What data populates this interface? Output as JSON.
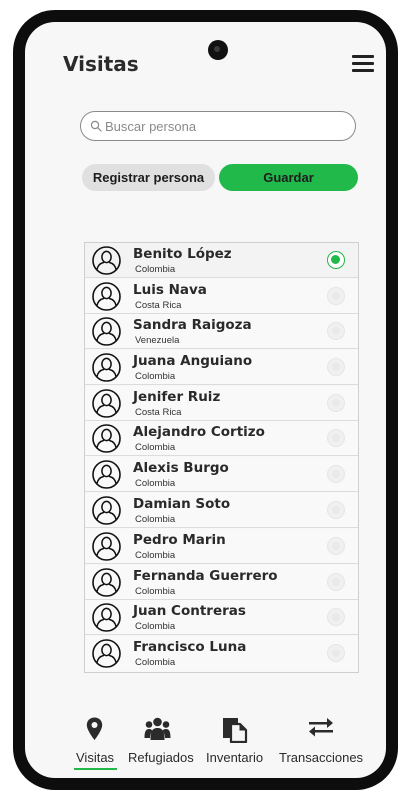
{
  "header": {
    "title": "Visitas",
    "menu_icon": "hamburger-menu-icon"
  },
  "search": {
    "placeholder": "Buscar persona",
    "value": "",
    "icon": "search-icon"
  },
  "actions": {
    "register_label": "Registrar persona",
    "save_label": "Guardar"
  },
  "colors": {
    "accent": "#22b94b",
    "secondary_button": "#e0e0e0",
    "phone_frame": "#0d0d0d",
    "screen_bg": "#f7f7f7"
  },
  "people": [
    {
      "name": "Benito López",
      "country": "Colombia",
      "selected": true
    },
    {
      "name": "Luis Nava",
      "country": "Costa Rica",
      "selected": false
    },
    {
      "name": "Sandra Raigoza",
      "country": "Venezuela",
      "selected": false
    },
    {
      "name": "Juana Anguiano",
      "country": "Colombia",
      "selected": false
    },
    {
      "name": "Jenifer Ruiz",
      "country": "Costa Rica",
      "selected": false
    },
    {
      "name": "Alejandro Cortizo",
      "country": "Colombia",
      "selected": false
    },
    {
      "name": "Alexis Burgo",
      "country": "Colombia",
      "selected": false
    },
    {
      "name": "Damian Soto",
      "country": "Colombia",
      "selected": false
    },
    {
      "name": "Pedro Marin",
      "country": "Colombia",
      "selected": false
    },
    {
      "name": "Fernanda Guerrero",
      "country": "Colombia",
      "selected": false
    },
    {
      "name": "Juan Contreras",
      "country": "Colombia",
      "selected": false
    },
    {
      "name": "Francisco Luna",
      "country": "Colombia",
      "selected": false
    }
  ],
  "bottom_nav": [
    {
      "label": "Visitas",
      "icon": "map-pin-icon",
      "active": true
    },
    {
      "label": "Refugiados",
      "icon": "users-icon",
      "active": false
    },
    {
      "label": "Inventario",
      "icon": "documents-icon",
      "active": false
    },
    {
      "label": "Transacciones",
      "icon": "exchange-arrows-icon",
      "active": false
    }
  ]
}
